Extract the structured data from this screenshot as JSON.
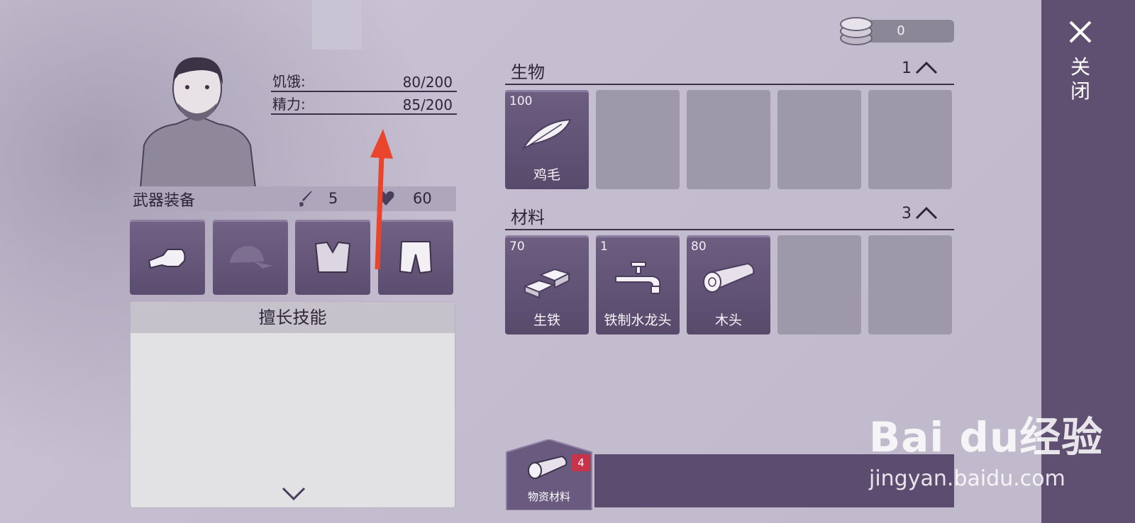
{
  "character": {
    "stats": [
      {
        "label": "饥饿:",
        "value": "80/200"
      },
      {
        "label": "精力:",
        "value": "85/200"
      }
    ]
  },
  "weapons": {
    "title": "武器装备",
    "attack": "5",
    "health": "60",
    "slots": [
      "fist-icon",
      "cap-icon",
      "vest-icon",
      "shorts-icon"
    ]
  },
  "skills": {
    "title": "擅长技能"
  },
  "currency": {
    "amount": "0"
  },
  "inventory": {
    "sections": [
      {
        "title": "生物",
        "count": "1",
        "items": [
          {
            "qty": "100",
            "name": "鸡毛",
            "icon": "feather-icon"
          }
        ]
      },
      {
        "title": "材料",
        "count": "3",
        "items": [
          {
            "qty": "70",
            "name": "生铁",
            "icon": "iron-ingot-icon"
          },
          {
            "qty": "1",
            "name": "铁制水龙头",
            "icon": "faucet-icon"
          },
          {
            "qty": "80",
            "name": "木头",
            "icon": "wood-log-icon"
          }
        ]
      }
    ]
  },
  "bottom_tab": {
    "label": "物资材料",
    "badge": "4"
  },
  "close": {
    "label": "关闭"
  },
  "watermark": {
    "logo": "Bai du经验",
    "url": "jingyan.baidu.com"
  },
  "colors": {
    "accent": "#5f5072",
    "slot": "#6d5e82",
    "badge": "#c7344a",
    "arrow": "#e8452c"
  }
}
